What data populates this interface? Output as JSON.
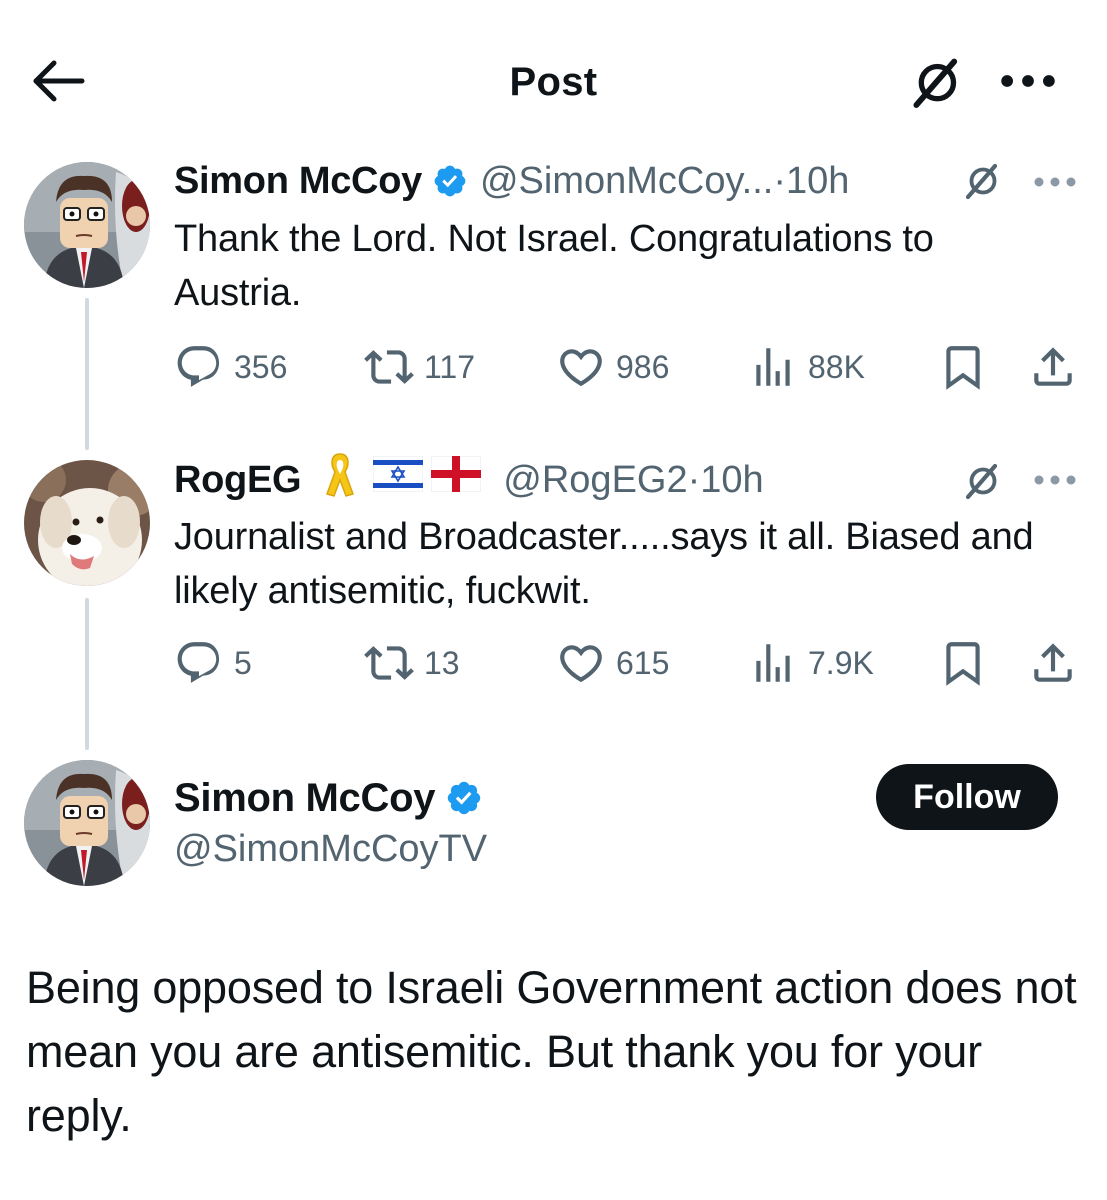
{
  "header": {
    "title": "Post",
    "back_icon": "arrow-left-icon",
    "grok_icon": "grok-icon",
    "more_icon": "more-horizontal-icon"
  },
  "colors": {
    "verified": "#1d9bf0",
    "text": "#0f1419",
    "secondary": "#536471",
    "thread_line": "#cfd9de",
    "follow_bg": "#0f1419"
  },
  "tweets": [
    {
      "name": "Simon McCoy",
      "verified": true,
      "handle": "@SimonMcCoy...",
      "time": "·10h",
      "text": "Thank the Lord. Not Israel.  Congratulations to Austria.",
      "stats": {
        "replies": "356",
        "reposts": "117",
        "likes": "986",
        "views": "88K"
      }
    },
    {
      "name": "RogEG",
      "badges": [
        "yellow-ribbon-emoji",
        "israel-flag-emoji",
        "england-flag-emoji"
      ],
      "handle": "@RogEG2",
      "time": "·10h",
      "text": "Journalist and Broadcaster.....says it all. Biased and likely antisemitic, fuckwit.",
      "stats": {
        "replies": "5",
        "reposts": "13",
        "likes": "615",
        "views": "7.9K"
      }
    }
  ],
  "main_post": {
    "name": "Simon McCoy",
    "verified": true,
    "handle": "@SimonMcCoyTV",
    "follow_label": "Follow",
    "text": "Being opposed to Israeli Government action does not mean you are antisemitic. But thank you for your reply."
  }
}
